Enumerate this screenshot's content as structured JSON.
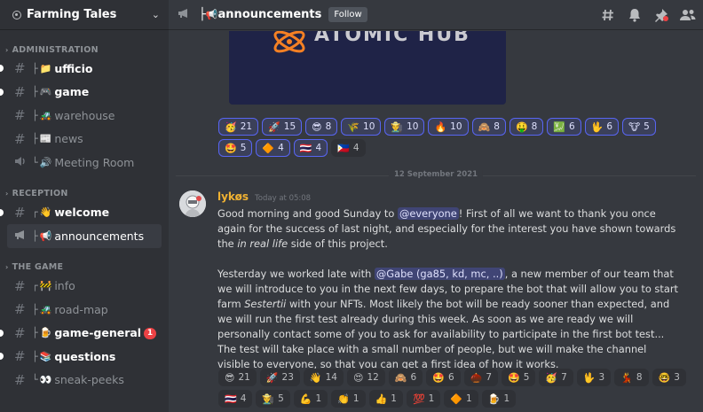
{
  "server": {
    "name": "Farming Tales"
  },
  "categories": [
    {
      "label": "ADMINISTRATION",
      "channels": [
        {
          "prefix": "├",
          "emoji": "📁",
          "name": "ufficio",
          "unread": true,
          "voice": false
        },
        {
          "prefix": "├",
          "emoji": "🎮",
          "name": "game",
          "unread": true,
          "voice": false
        },
        {
          "prefix": "├",
          "emoji": "🚜",
          "name": "warehouse",
          "unread": false,
          "voice": false
        },
        {
          "prefix": "├",
          "emoji": "📰",
          "name": "news",
          "unread": false,
          "voice": false
        },
        {
          "prefix": "└",
          "emoji": "🔊",
          "name": "Meeting Room",
          "unread": false,
          "voice": true
        }
      ]
    },
    {
      "label": "RECEPTION",
      "channels": [
        {
          "prefix": "┌",
          "emoji": "👋",
          "name": "welcome",
          "unread": true,
          "voice": false
        },
        {
          "prefix": "├",
          "emoji": "📢",
          "name": "announcements",
          "unread": false,
          "voice": false,
          "selected": true
        }
      ]
    },
    {
      "label": "THE GAME",
      "channels": [
        {
          "prefix": "┌",
          "emoji": "🚧",
          "name": "info",
          "unread": false,
          "voice": false
        },
        {
          "prefix": "├",
          "emoji": "🚜",
          "name": "road-map",
          "unread": false,
          "voice": false
        },
        {
          "prefix": "├",
          "emoji": "🍺",
          "name": "game-general",
          "unread": true,
          "voice": false,
          "badge": "1"
        },
        {
          "prefix": "├",
          "emoji": "📚",
          "name": "questions",
          "unread": true,
          "voice": false
        },
        {
          "prefix": "└",
          "emoji": "👀",
          "name": "sneak-peeks",
          "unread": false,
          "voice": false
        }
      ]
    }
  ],
  "topbar": {
    "channel_prefix": "├",
    "channel_emoji": "📢",
    "channel_name": "announcements",
    "follow_label": "Follow",
    "icons": [
      "threads-icon",
      "bell-icon",
      "pin-icon",
      "members-icon"
    ]
  },
  "embed_image": {
    "text": "ATOMIC HUB"
  },
  "reactions_top": [
    {
      "emoji": "🥳",
      "count": "21",
      "me": true
    },
    {
      "emoji": "🚀",
      "count": "15",
      "me": true
    },
    {
      "emoji": "😎",
      "count": "8",
      "me": true
    },
    {
      "emoji": "🌾",
      "count": "10",
      "me": true
    },
    {
      "emoji": "👨‍🌾",
      "count": "10",
      "me": true
    },
    {
      "emoji": "🔥",
      "count": "10",
      "me": true
    },
    {
      "emoji": "🙈",
      "count": "8",
      "me": true
    },
    {
      "emoji": "🤑",
      "count": "8",
      "me": true
    },
    {
      "emoji": "💹",
      "count": "6",
      "me": true
    },
    {
      "emoji": "🖖",
      "count": "6",
      "me": true
    },
    {
      "emoji": "🐮",
      "count": "5",
      "me": true
    },
    {
      "emoji": "🤩",
      "count": "5",
      "me": true
    },
    {
      "emoji": "🔶",
      "count": "4",
      "me": true
    },
    {
      "emoji": "🇹🇭",
      "count": "4",
      "me": true
    },
    {
      "emoji": "🇵🇭",
      "count": "4",
      "me": false
    }
  ],
  "date_divider": "12 September 2021",
  "message": {
    "author": "lykøs",
    "timestamp": "Today at 05:08",
    "p1_a": "Good morning and good Sunday to ",
    "p1_mention": "@everyone",
    "p1_b": "! First of all we want to thank you once again for the success of last night, and especially for the interest you have shown towards the ",
    "p1_italic": "in real life",
    "p1_c": " side of this project.",
    "p2_a": "Yesterday we worked late with ",
    "p2_mention": "@Gabe (ga85, kd, mc, ..)",
    "p2_b": ", a new member of our team that we will introduce to you in the next few days, to prepare the bot that will allow you to start farm ",
    "p2_italic": "Sestertii",
    "p2_c": " with your NFTs. Most likely the bot will be ready sooner than expected, and we will run the first test already during this week. As soon as we are ready we will personally contact some of you to ask for availability to participate in the first bot test... The test will take place with a small number of people, but we will make the channel visible to everyone, so that you can get a first idea of how it works."
  },
  "reactions_bottom": [
    {
      "emoji": "😎",
      "count": "21",
      "me": false
    },
    {
      "emoji": "🚀",
      "count": "23",
      "me": false
    },
    {
      "emoji": "👋",
      "count": "14",
      "me": false
    },
    {
      "emoji": "😍",
      "count": "12",
      "me": false
    },
    {
      "emoji": "🙈",
      "count": "6",
      "me": false
    },
    {
      "emoji": "🤩",
      "count": "6",
      "me": false
    },
    {
      "emoji": "🌰",
      "count": "7",
      "me": false
    },
    {
      "emoji": "🤩",
      "count": "5",
      "me": false
    },
    {
      "emoji": "🥳",
      "count": "7",
      "me": false
    },
    {
      "emoji": "🖖",
      "count": "3",
      "me": false
    },
    {
      "emoji": "💃",
      "count": "8",
      "me": false
    },
    {
      "emoji": "🤓",
      "count": "3",
      "me": false
    },
    {
      "emoji": "🇹🇭",
      "count": "4",
      "me": false
    },
    {
      "emoji": "👨‍🌾",
      "count": "5",
      "me": false
    },
    {
      "emoji": "💪",
      "count": "1",
      "me": false
    },
    {
      "emoji": "👏",
      "count": "1",
      "me": false
    },
    {
      "emoji": "👍",
      "count": "1",
      "me": false
    },
    {
      "emoji": "💯",
      "count": "1",
      "me": false
    },
    {
      "emoji": "🔶",
      "count": "1",
      "me": false
    },
    {
      "emoji": "🍺",
      "count": "1",
      "me": false
    }
  ]
}
